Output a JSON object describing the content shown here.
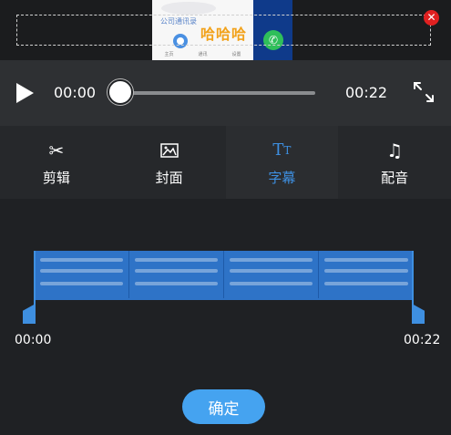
{
  "preview": {
    "subtitle_text": "哈哈哈",
    "frame_header_text": "公司通讯录",
    "frame_tabs": [
      "主页",
      "通讯",
      "设置"
    ],
    "close_icon": "close-icon",
    "colors": {
      "subtitle": "#f2a21b",
      "close": "#e02020"
    }
  },
  "player": {
    "current_time": "00:00",
    "total_time": "00:22",
    "progress": 0,
    "play_icon": "play-icon",
    "fullscreen_icon": "fullscreen-icon"
  },
  "tabs": [
    {
      "label": "剪辑",
      "icon": "scissors-icon",
      "active": false
    },
    {
      "label": "封面",
      "icon": "image-icon",
      "active": false
    },
    {
      "label": "字幕",
      "icon": "text-icon",
      "active": true
    },
    {
      "label": "配音",
      "icon": "music-note-icon",
      "active": false
    }
  ],
  "timeline": {
    "start_time": "00:00",
    "end_time": "00:22",
    "accent": "#3e8fe0"
  },
  "confirm": {
    "label": "确定",
    "color": "#45a3f0"
  }
}
